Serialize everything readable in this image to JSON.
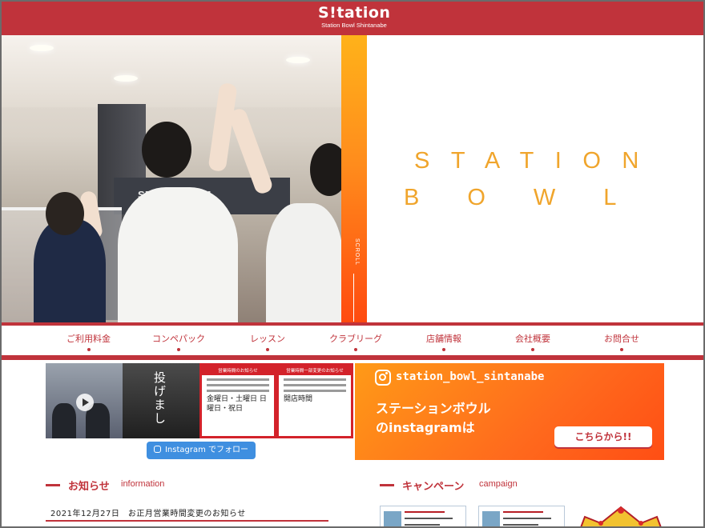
{
  "header": {
    "logo_text": "S!tation",
    "logo_subtitle": "Station Bowl Shintanabe",
    "brand_color": "#c0333b"
  },
  "hero": {
    "title_line1": "STATION",
    "title_line2": [
      "B",
      "O",
      "W",
      "L"
    ],
    "scroll_label": "SCROLL",
    "photo_sign_text": "ST  RS ROOM",
    "accent_gradient": [
      "#ffb21a",
      "#ff4a0f"
    ]
  },
  "nav": {
    "items": [
      {
        "label": "ご利用料金"
      },
      {
        "label": "コンペパック"
      },
      {
        "label": "レッスン"
      },
      {
        "label": "クラブリーグ"
      },
      {
        "label": "店舗情報"
      },
      {
        "label": "会社概要"
      },
      {
        "label": "お問合せ"
      }
    ]
  },
  "instagram": {
    "follow_button": "Instagram でフォロー",
    "handle": "station_bowl_sintanabe",
    "line1": "ステーションボウル",
    "line2": "のinstagramは",
    "cta": "こちらから!!",
    "thumb_notice_1": "営業時間のお知らせ",
    "thumb_notice_2": "営業時間一部変更のお知らせ",
    "thumb_text_2": "金曜日・土曜日 日曜日・祝日",
    "thumb_text_3": "開店時間",
    "thumb_vertical_text": "投げまし"
  },
  "news": {
    "title": "お知らせ",
    "subtitle": "information",
    "items": [
      {
        "date": "2021年12月27日",
        "text": "お正月営業時間変更のお知らせ"
      }
    ]
  },
  "campaign": {
    "title": "キャンペーン",
    "subtitle": "campaign"
  }
}
